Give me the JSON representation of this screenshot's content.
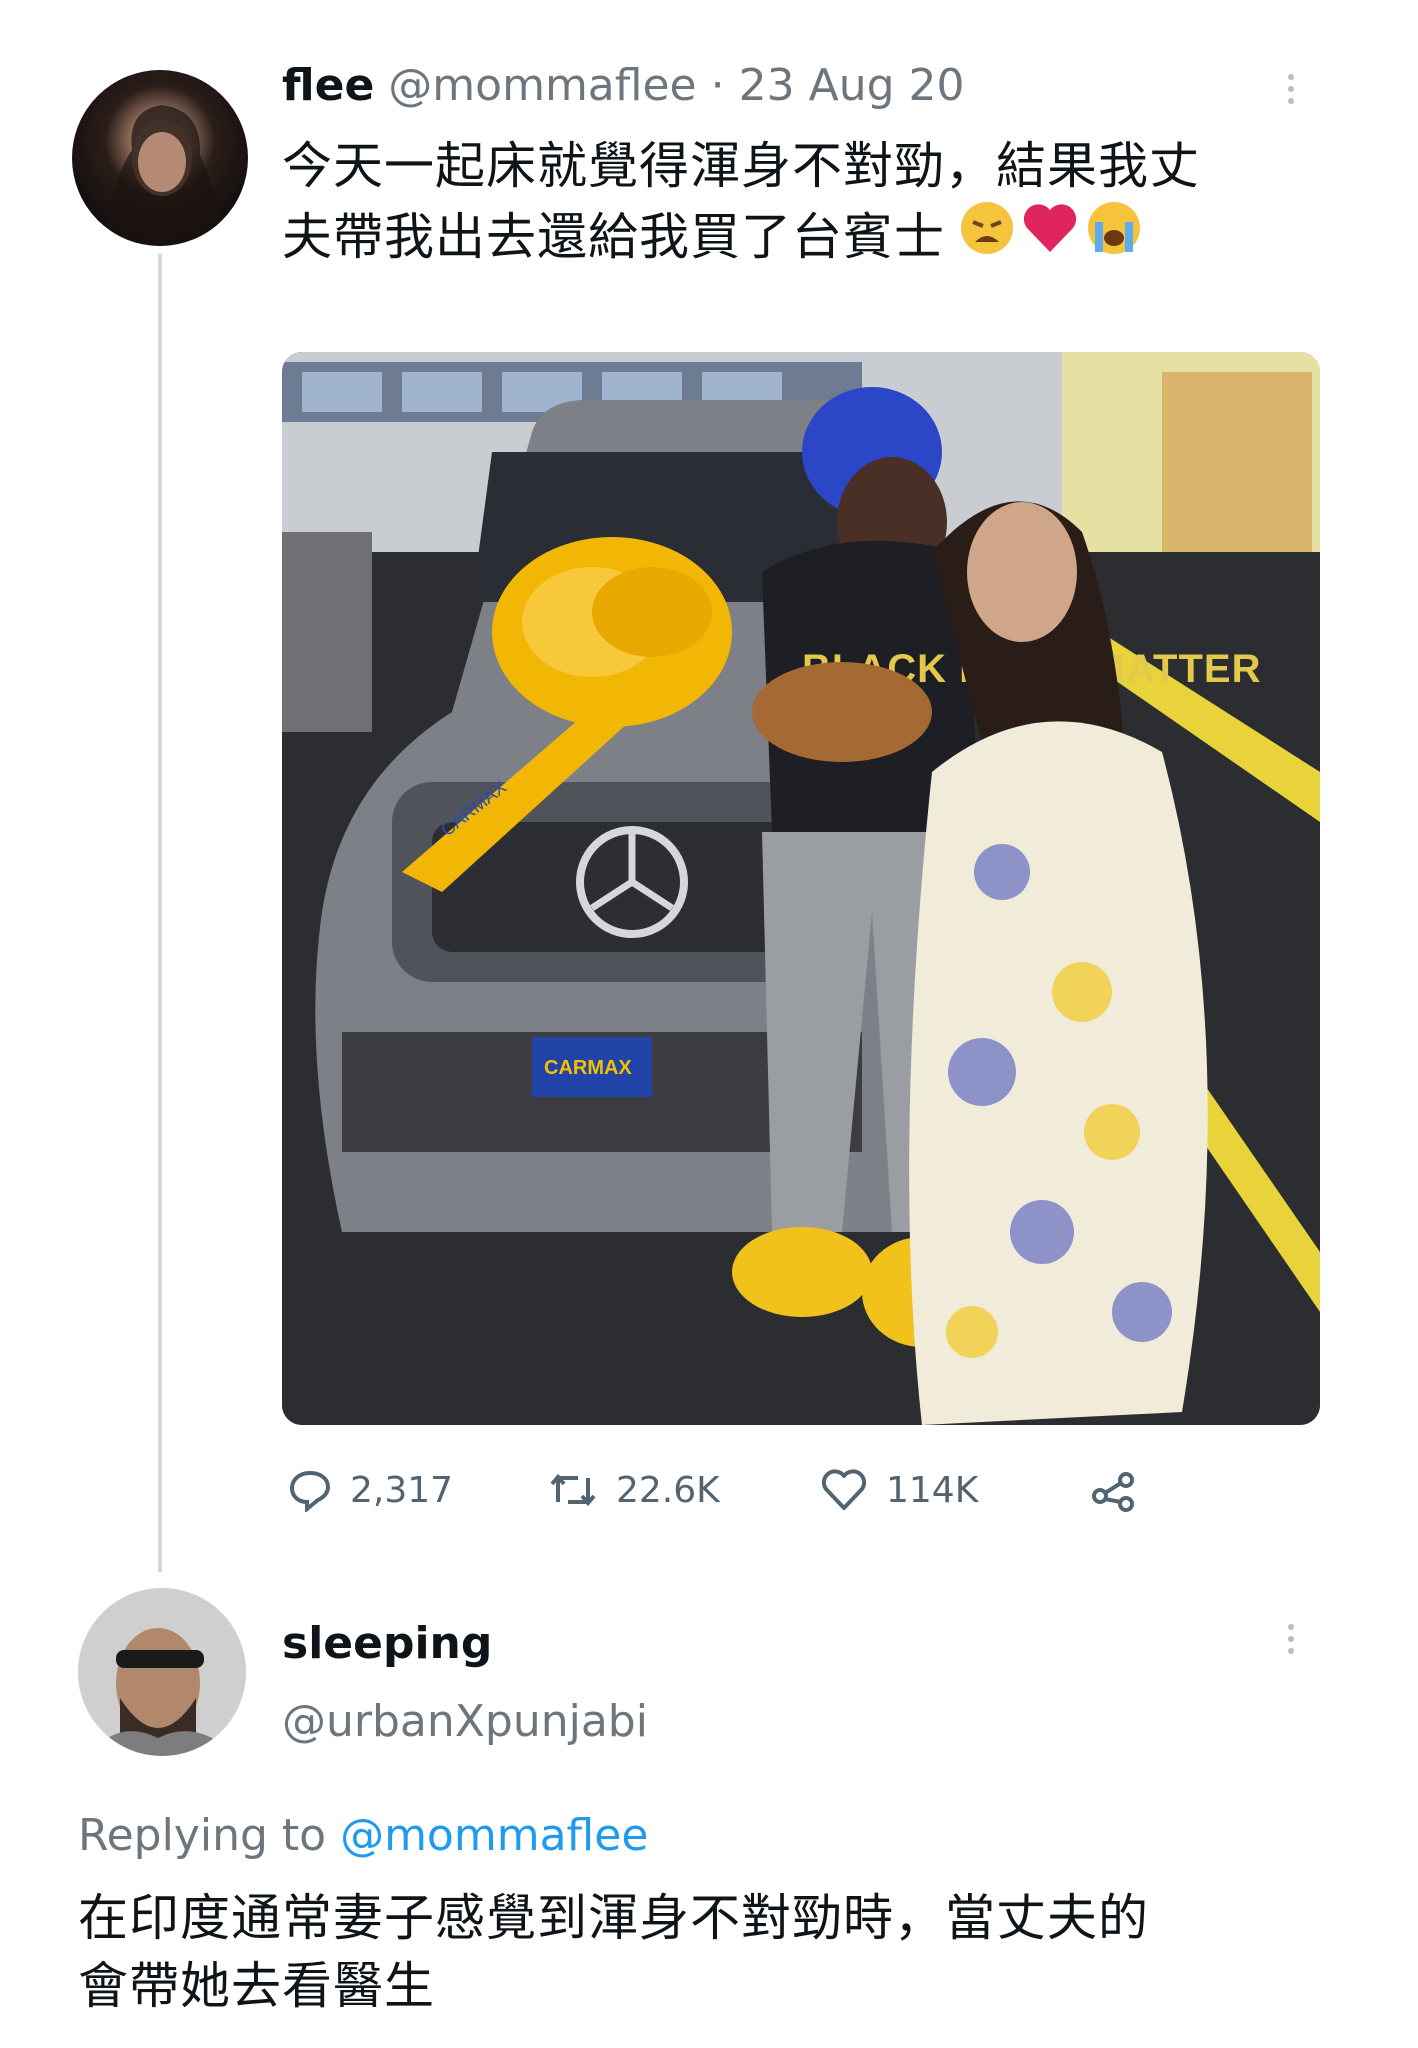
{
  "tweet": {
    "display_name": "flee",
    "handle": "@mommaflee",
    "separator": "·",
    "date": "23 Aug 20",
    "text_line1": "今天一起床就覺得渾身不對勁，結果我丈",
    "text_line2": "夫帶我出去還給我買了台賓士",
    "emojis": [
      "weary-face-emoji",
      "red-heart-emoji",
      "loudly-crying-face-emoji"
    ],
    "stats": {
      "replies": "2,317",
      "retweets": "22.6K",
      "likes": "114K"
    },
    "photo_lettering": [
      "CARMAX",
      "BLACK LIVES MATTER"
    ]
  },
  "reply": {
    "display_name": "sleeping",
    "handle": "@urbanXpunjabi",
    "replying_to_prefix": "Replying to",
    "replying_to_handle": "@mommaflee",
    "text_line1": "在印度通常妻子感覺到渾身不對勁時，當丈夫的",
    "text_line2": "會帶她去看醫生"
  },
  "colors": {
    "link": "#1d9bf0",
    "muted": "#6e767d",
    "text": "#0f1419",
    "heart": "#e0245e",
    "bow": "#f2b705"
  }
}
